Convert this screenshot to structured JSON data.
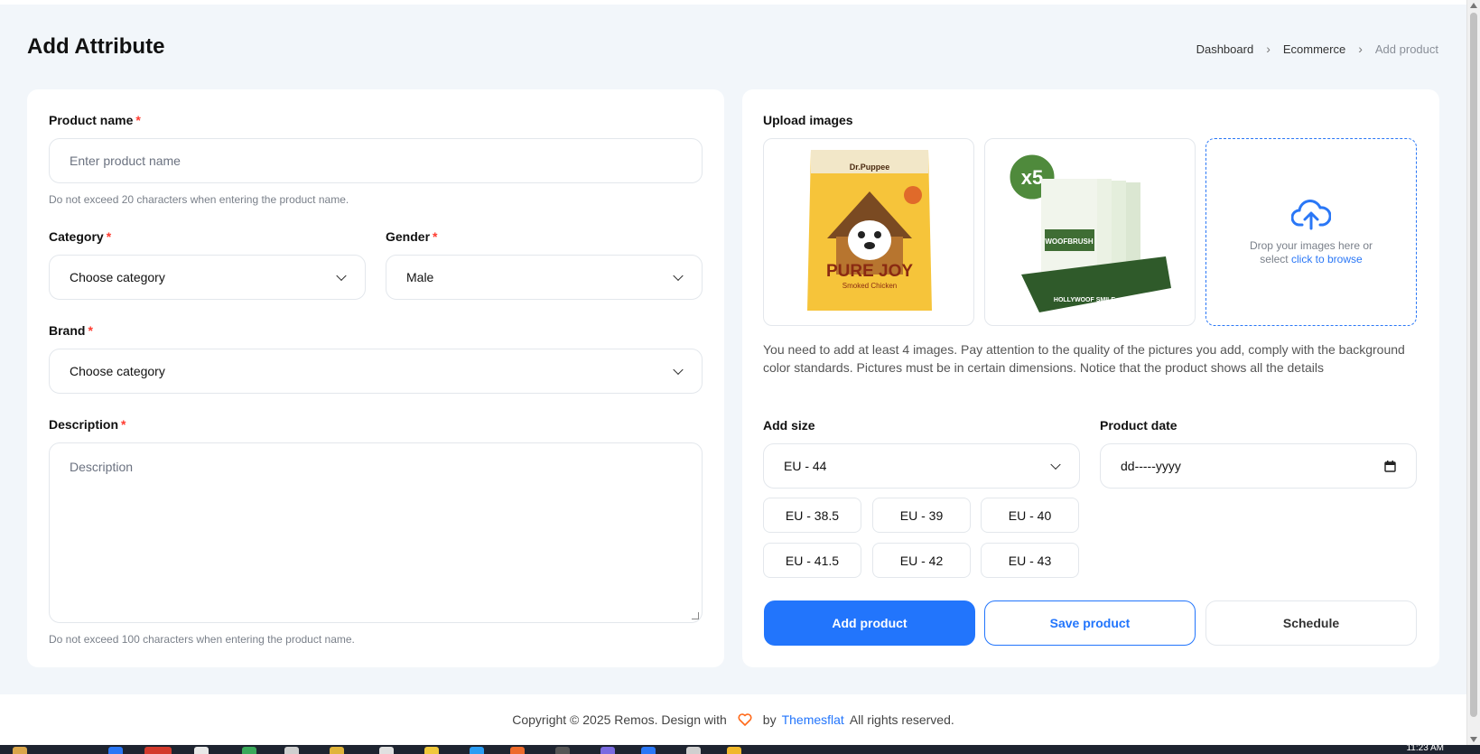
{
  "page": {
    "title": "Add Attribute"
  },
  "breadcrumb": {
    "items": [
      "Dashboard",
      "Ecommerce",
      "Add product"
    ]
  },
  "form": {
    "product_name": {
      "label": "Product name",
      "required": "*",
      "placeholder": "Enter product name",
      "hint": "Do not exceed 20 characters when entering the product name."
    },
    "category": {
      "label": "Category",
      "required": "*",
      "value": "Choose category"
    },
    "gender": {
      "label": "Gender",
      "required": "*",
      "value": "Male"
    },
    "brand": {
      "label": "Brand",
      "required": "*",
      "value": "Choose category"
    },
    "description": {
      "label": "Description",
      "required": "*",
      "placeholder": "Description",
      "hint": "Do not exceed 100 characters when entering the product name."
    }
  },
  "upload": {
    "label": "Upload images",
    "image1": {
      "brand": "Dr.Puppee",
      "name": "PURE JOY",
      "sub": "Smoked Chicken"
    },
    "image2": {
      "badge": "x5",
      "name": "WOOFBRUSH",
      "sub": "HOLLYWOOF SMILE"
    },
    "drop_text": "Drop your images here or select",
    "drop_link": "click to browse",
    "note": "You need to add at least 4 images. Pay attention to the quality of the pictures you add, comply with the background color standards. Pictures must be in certain dimensions. Notice that the product shows all the details"
  },
  "size": {
    "label": "Add size",
    "value": "EU - 44",
    "options": [
      "EU - 38.5",
      "EU - 39",
      "EU - 40",
      "EU - 41.5",
      "EU - 42",
      "EU - 43"
    ]
  },
  "product_date": {
    "label": "Product date",
    "value": "dd-----yyyy"
  },
  "actions": {
    "add": "Add product",
    "save": "Save product",
    "schedule": "Schedule"
  },
  "footer": {
    "before": "Copyright © 2025 Remos. Design with",
    "by": "by",
    "brand": "Themesflat",
    "after": "All rights reserved."
  },
  "taskbar": {
    "time": "11:23 AM"
  },
  "colors": {
    "accent": "#2275fc",
    "required": "#ff3b30",
    "heart": "#ff6a1a"
  }
}
